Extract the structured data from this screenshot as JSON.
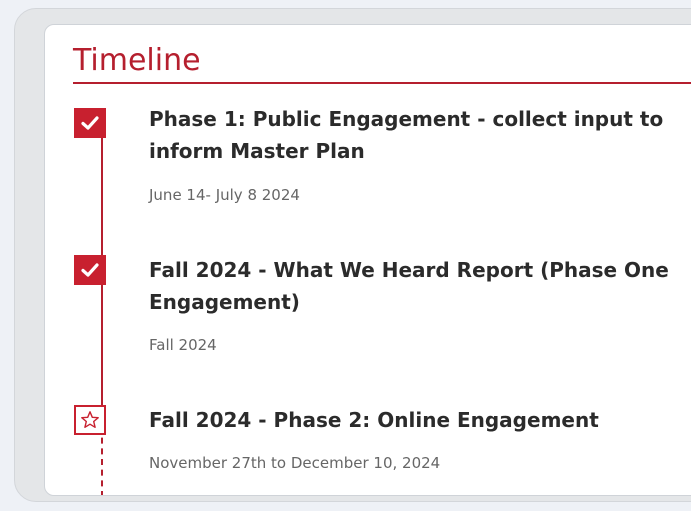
{
  "timeline": {
    "title": "Timeline",
    "accent_color": "#c8202f",
    "items": [
      {
        "title": "Phase 1: Public Engagement - collect input to inform Master Plan",
        "date": "June 14- July 8 2024",
        "status": "completed",
        "icon": "checkmark-icon"
      },
      {
        "title": "Fall 2024 - What We Heard Report (Phase One Engagement)",
        "date": "Fall 2024",
        "status": "completed",
        "icon": "checkmark-icon"
      },
      {
        "title": "Fall 2024 - Phase 2: Online Engagement",
        "date": "November 27th to December 10, 2024",
        "status": "upcoming",
        "icon": "star-icon"
      }
    ]
  }
}
